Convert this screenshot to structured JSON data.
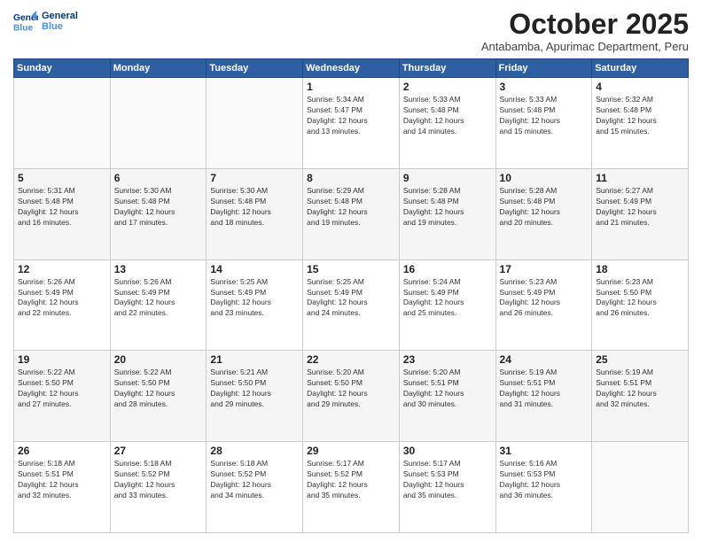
{
  "logo": {
    "line1": "General",
    "line2": "Blue"
  },
  "title": "October 2025",
  "subtitle": "Antabamba, Apurimac Department, Peru",
  "weekdays": [
    "Sunday",
    "Monday",
    "Tuesday",
    "Wednesday",
    "Thursday",
    "Friday",
    "Saturday"
  ],
  "weeks": [
    [
      {
        "day": "",
        "info": ""
      },
      {
        "day": "",
        "info": ""
      },
      {
        "day": "",
        "info": ""
      },
      {
        "day": "1",
        "info": "Sunrise: 5:34 AM\nSunset: 5:47 PM\nDaylight: 12 hours\nand 13 minutes."
      },
      {
        "day": "2",
        "info": "Sunrise: 5:33 AM\nSunset: 5:48 PM\nDaylight: 12 hours\nand 14 minutes."
      },
      {
        "day": "3",
        "info": "Sunrise: 5:33 AM\nSunset: 5:48 PM\nDaylight: 12 hours\nand 15 minutes."
      },
      {
        "day": "4",
        "info": "Sunrise: 5:32 AM\nSunset: 5:48 PM\nDaylight: 12 hours\nand 15 minutes."
      }
    ],
    [
      {
        "day": "5",
        "info": "Sunrise: 5:31 AM\nSunset: 5:48 PM\nDaylight: 12 hours\nand 16 minutes."
      },
      {
        "day": "6",
        "info": "Sunrise: 5:30 AM\nSunset: 5:48 PM\nDaylight: 12 hours\nand 17 minutes."
      },
      {
        "day": "7",
        "info": "Sunrise: 5:30 AM\nSunset: 5:48 PM\nDaylight: 12 hours\nand 18 minutes."
      },
      {
        "day": "8",
        "info": "Sunrise: 5:29 AM\nSunset: 5:48 PM\nDaylight: 12 hours\nand 19 minutes."
      },
      {
        "day": "9",
        "info": "Sunrise: 5:28 AM\nSunset: 5:48 PM\nDaylight: 12 hours\nand 19 minutes."
      },
      {
        "day": "10",
        "info": "Sunrise: 5:28 AM\nSunset: 5:48 PM\nDaylight: 12 hours\nand 20 minutes."
      },
      {
        "day": "11",
        "info": "Sunrise: 5:27 AM\nSunset: 5:49 PM\nDaylight: 12 hours\nand 21 minutes."
      }
    ],
    [
      {
        "day": "12",
        "info": "Sunrise: 5:26 AM\nSunset: 5:49 PM\nDaylight: 12 hours\nand 22 minutes."
      },
      {
        "day": "13",
        "info": "Sunrise: 5:26 AM\nSunset: 5:49 PM\nDaylight: 12 hours\nand 22 minutes."
      },
      {
        "day": "14",
        "info": "Sunrise: 5:25 AM\nSunset: 5:49 PM\nDaylight: 12 hours\nand 23 minutes."
      },
      {
        "day": "15",
        "info": "Sunrise: 5:25 AM\nSunset: 5:49 PM\nDaylight: 12 hours\nand 24 minutes."
      },
      {
        "day": "16",
        "info": "Sunrise: 5:24 AM\nSunset: 5:49 PM\nDaylight: 12 hours\nand 25 minutes."
      },
      {
        "day": "17",
        "info": "Sunrise: 5:23 AM\nSunset: 5:49 PM\nDaylight: 12 hours\nand 26 minutes."
      },
      {
        "day": "18",
        "info": "Sunrise: 5:23 AM\nSunset: 5:50 PM\nDaylight: 12 hours\nand 26 minutes."
      }
    ],
    [
      {
        "day": "19",
        "info": "Sunrise: 5:22 AM\nSunset: 5:50 PM\nDaylight: 12 hours\nand 27 minutes."
      },
      {
        "day": "20",
        "info": "Sunrise: 5:22 AM\nSunset: 5:50 PM\nDaylight: 12 hours\nand 28 minutes."
      },
      {
        "day": "21",
        "info": "Sunrise: 5:21 AM\nSunset: 5:50 PM\nDaylight: 12 hours\nand 29 minutes."
      },
      {
        "day": "22",
        "info": "Sunrise: 5:20 AM\nSunset: 5:50 PM\nDaylight: 12 hours\nand 29 minutes."
      },
      {
        "day": "23",
        "info": "Sunrise: 5:20 AM\nSunset: 5:51 PM\nDaylight: 12 hours\nand 30 minutes."
      },
      {
        "day": "24",
        "info": "Sunrise: 5:19 AM\nSunset: 5:51 PM\nDaylight: 12 hours\nand 31 minutes."
      },
      {
        "day": "25",
        "info": "Sunrise: 5:19 AM\nSunset: 5:51 PM\nDaylight: 12 hours\nand 32 minutes."
      }
    ],
    [
      {
        "day": "26",
        "info": "Sunrise: 5:18 AM\nSunset: 5:51 PM\nDaylight: 12 hours\nand 32 minutes."
      },
      {
        "day": "27",
        "info": "Sunrise: 5:18 AM\nSunset: 5:52 PM\nDaylight: 12 hours\nand 33 minutes."
      },
      {
        "day": "28",
        "info": "Sunrise: 5:18 AM\nSunset: 5:52 PM\nDaylight: 12 hours\nand 34 minutes."
      },
      {
        "day": "29",
        "info": "Sunrise: 5:17 AM\nSunset: 5:52 PM\nDaylight: 12 hours\nand 35 minutes."
      },
      {
        "day": "30",
        "info": "Sunrise: 5:17 AM\nSunset: 5:53 PM\nDaylight: 12 hours\nand 35 minutes."
      },
      {
        "day": "31",
        "info": "Sunrise: 5:16 AM\nSunset: 5:53 PM\nDaylight: 12 hours\nand 36 minutes."
      },
      {
        "day": "",
        "info": ""
      }
    ]
  ]
}
